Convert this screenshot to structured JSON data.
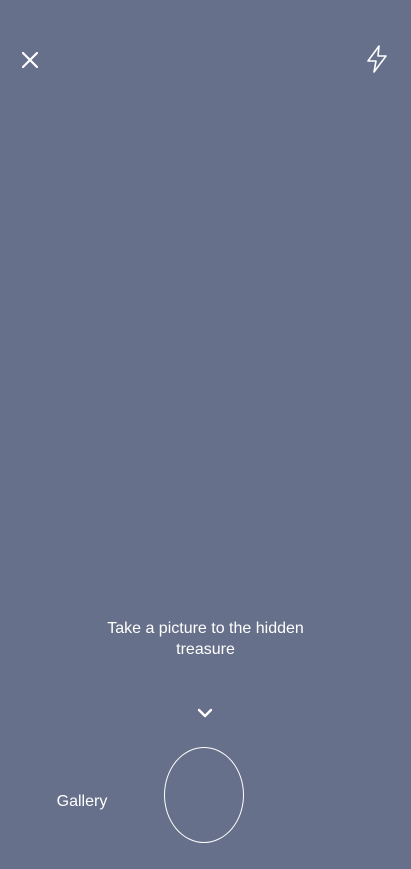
{
  "camera": {
    "hint_text": "Take a picture to the hidden treasure",
    "gallery_label": "Gallery"
  },
  "icons": {
    "close": "close-icon",
    "flash": "flash-icon",
    "chevron": "chevron-down-icon"
  },
  "colors": {
    "background": "#67708a",
    "foreground": "#ffffff"
  }
}
